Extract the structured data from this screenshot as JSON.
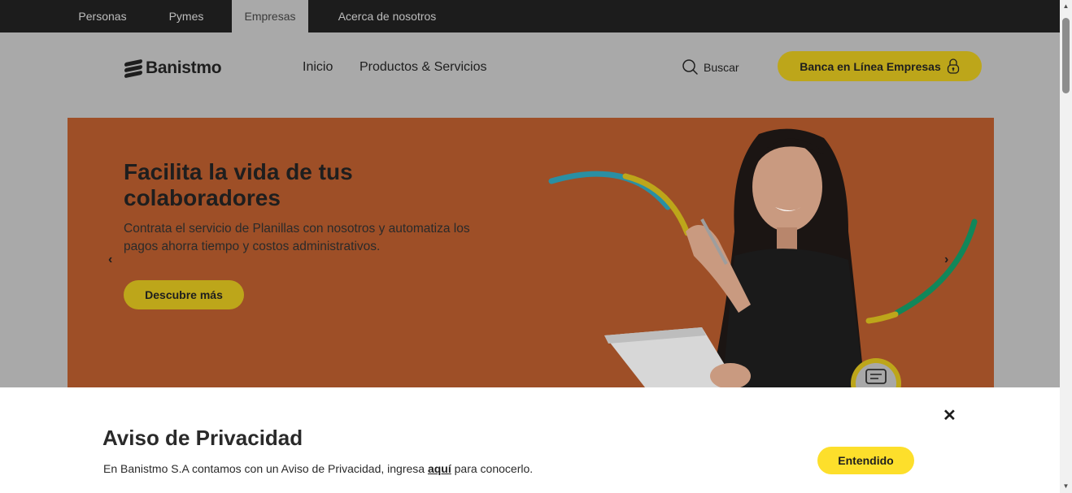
{
  "segments": {
    "items": [
      {
        "label": "Personas"
      },
      {
        "label": "Pymes"
      },
      {
        "label": "Empresas",
        "active": true
      },
      {
        "label": "Acerca de nosotros"
      }
    ]
  },
  "header": {
    "logo_text": "Banistmo",
    "nav": [
      {
        "label": "Inicio"
      },
      {
        "label": "Productos & Servicios"
      }
    ],
    "search_label": "Buscar",
    "online_banking_label": "Banca en Línea Empresas"
  },
  "hero": {
    "title": "Facilita la vida de tus colaboradores",
    "text": "Contrata el servicio de Planillas con nosotros y automatiza los pagos ahorra tiempo y costos administrativos.",
    "cta_label": "Descubre más",
    "prev_icon": "chevron-left-icon",
    "next_icon": "chevron-right-icon"
  },
  "privacy": {
    "title": "Aviso de Privacidad",
    "text_before": "En Banistmo S.A contamos con un Aviso de Privacidad, ingresa ",
    "link_label": "aquí",
    "text_after": " para conocerlo.",
    "close_icon": "close-icon",
    "accept_label": "Entendido"
  },
  "colors": {
    "brand_yellow": "#fddf2b",
    "hero_orange": "#9e4f27",
    "topbar_dark": "#1c1c1c"
  }
}
